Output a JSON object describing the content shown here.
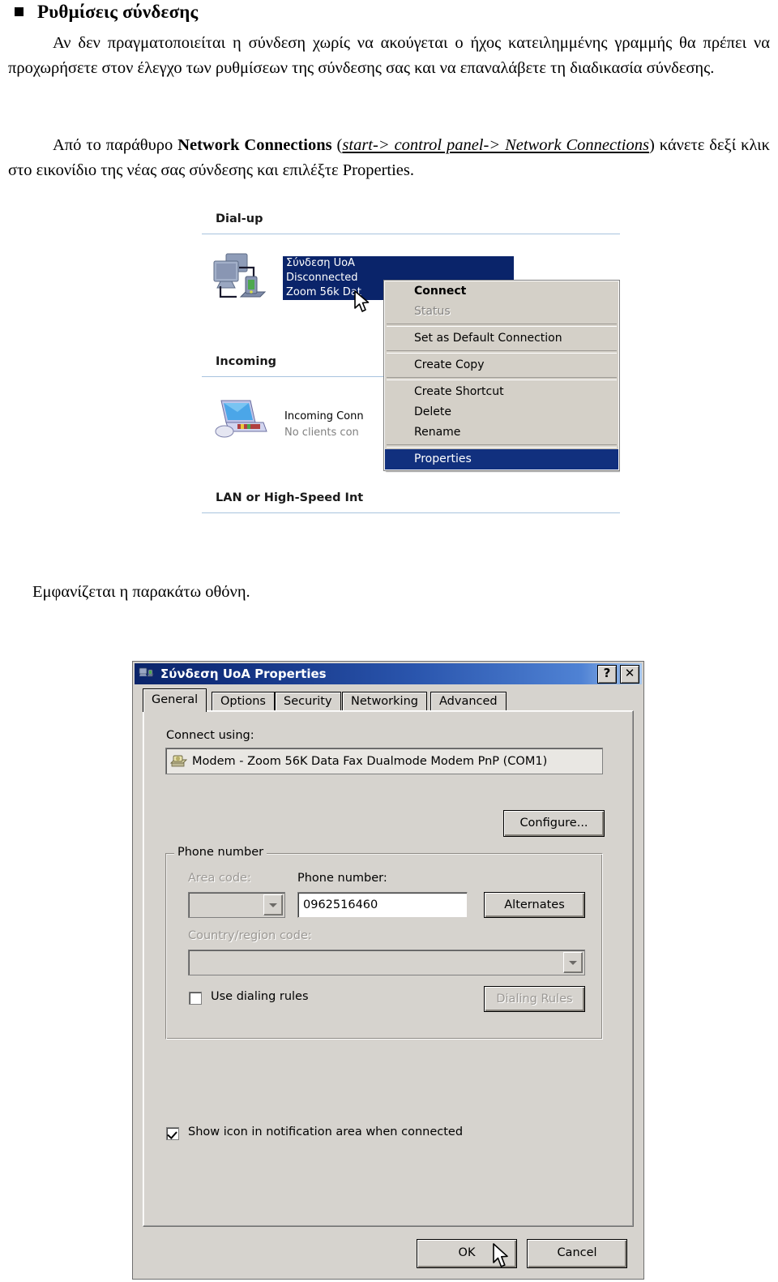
{
  "document": {
    "heading": "Ρυθμίσεις σύνδεσης",
    "paragraph1": "Αν δεν πραγματοποιείται η σύνδεση χωρίς να ακούγεται ο ήχος κατειλημμένης γραμμής θα πρέπει να προχωρήσετε στον έλεγχο των ρυθμίσεων της σύνδεσης σας και να επαναλάβετε τη διαδικασία σύνδεσης.",
    "paragraph2": {
      "lead": "Από το παράθυρο ",
      "bold": "Network Connections",
      "mid_open": " (",
      "italic_underline": "start-> control panel-> Network Connections",
      "mid_close": ") ",
      "tail": "κάνετε δεξί κλικ στο εικονίδιο της νέας σας σύνδεσης και επιλέξτε Properties."
    },
    "paragraph3": "Εμφανίζεται η παρακάτω οθόνη."
  },
  "network_connections": {
    "groups": [
      {
        "title": "Dial-up"
      },
      {
        "title": "Incoming"
      },
      {
        "title": "LAN or High-Speed Int"
      }
    ],
    "dialup_item": {
      "name": "Σύνδεση UoA",
      "status": "Disconnected",
      "device": "Zoom 56k Dat",
      "icon": "dialup-connection-icon"
    },
    "incoming_item": {
      "name": "Incoming Conn",
      "status": "No clients con",
      "icon": "incoming-connection-icon"
    },
    "context_menu": [
      {
        "label": "Connect",
        "style": "bold"
      },
      {
        "label": "Status",
        "style": "disabled"
      },
      {
        "separator": true
      },
      {
        "label": "Set as Default Connection",
        "style": "normal"
      },
      {
        "separator": true
      },
      {
        "label": "Create Copy",
        "style": "normal"
      },
      {
        "separator": true
      },
      {
        "label": "Create Shortcut",
        "style": "normal"
      },
      {
        "label": "Delete",
        "style": "normal"
      },
      {
        "label": "Rename",
        "style": "normal"
      },
      {
        "separator": true
      },
      {
        "label": "Properties",
        "style": "highlight"
      }
    ],
    "colors": {
      "selection": "#0a246a",
      "menu_highlight": "#11307e",
      "menu_face": "#d4d0c8",
      "group_rule": "#a8c4de"
    }
  },
  "properties_dialog": {
    "title": "Σύνδεση UoA Properties",
    "title_icon": "dialup-connection-icon",
    "help_button": "?",
    "close_button": "✕",
    "tabs": [
      {
        "label": "General",
        "active": true
      },
      {
        "label": "Options",
        "active": false
      },
      {
        "label": "Security",
        "active": false
      },
      {
        "label": "Networking",
        "active": false
      },
      {
        "label": "Advanced",
        "active": false
      }
    ],
    "connect_using": {
      "label": "Connect using:",
      "device": "Modem - Zoom 56K Data Fax Dualmode Modem PnP (COM1)",
      "device_icon": "modem-icon",
      "configure_button": "Configure..."
    },
    "phone_number_group": {
      "title": "Phone number",
      "area_code_label": "Area code:",
      "area_code_value": "",
      "phone_number_label": "Phone number:",
      "phone_number_value": "0962516460",
      "alternates_button": "Alternates",
      "country_code_label": "Country/region code:",
      "country_code_value": "",
      "use_dialing_rules_label": "Use dialing rules",
      "use_dialing_rules_checked": false,
      "dialing_rules_button": "Dialing Rules"
    },
    "show_icon": {
      "label": "Show icon in notification area when connected",
      "checked": true
    },
    "ok_button": "OK",
    "cancel_button": "Cancel",
    "colors": {
      "face": "#d6d3ce",
      "titlebar_start": "#0a246a",
      "titlebar_end": "#a8c8ee"
    }
  }
}
